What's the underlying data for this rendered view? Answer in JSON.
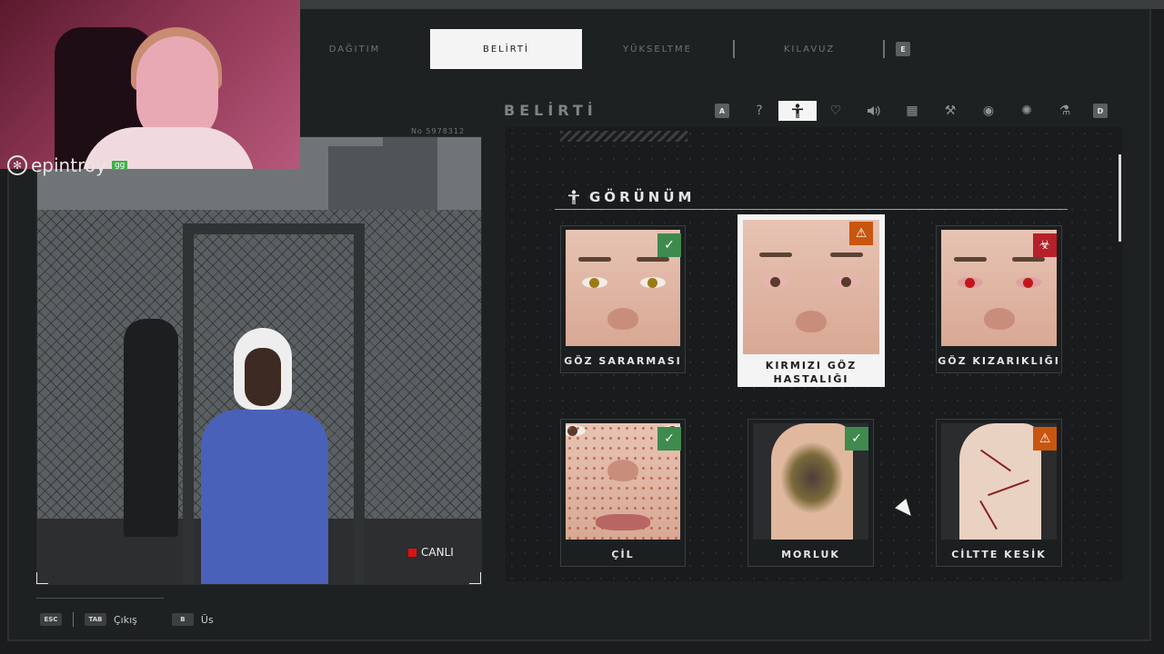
{
  "tabs": [
    {
      "label": "DAĞITIM",
      "active": false
    },
    {
      "label": "BELİRTİ",
      "active": true
    },
    {
      "label": "YÜKSELTME",
      "active": false
    },
    {
      "label": "KILAVUZ",
      "active": false
    }
  ],
  "tab_key_right": "E",
  "camera": {
    "id_text": "No 5978312",
    "live_label": "CANLI"
  },
  "webcam": {
    "brand": "epintroy",
    "brand_badge": "gg"
  },
  "panel": {
    "title": "BELİRTİ",
    "key_left": "A",
    "key_right": "D",
    "categories": [
      {
        "icon": "question-icon",
        "glyph": "?",
        "active": false
      },
      {
        "icon": "body-icon",
        "glyph": "🕴",
        "active": true
      },
      {
        "icon": "heartbeat-icon",
        "glyph": "♡",
        "active": false
      },
      {
        "icon": "sound-icon",
        "glyph": "🔊",
        "active": false
      },
      {
        "icon": "briefcase-icon",
        "glyph": "▦",
        "active": false
      },
      {
        "icon": "tools-icon",
        "glyph": "⚒",
        "active": false
      },
      {
        "icon": "eye-icon",
        "glyph": "◉",
        "active": false
      },
      {
        "icon": "virus-icon",
        "glyph": "✺",
        "active": false
      },
      {
        "icon": "flask-icon",
        "glyph": "⚗",
        "active": false
      }
    ],
    "section_title": "GÖRÜNÜM",
    "cards": [
      {
        "label": "GÖZ SARARMASI",
        "status": "ok",
        "status_icon": "check-shield-icon"
      },
      {
        "label_line1": "KIRMIZI GÖZ",
        "label_line2": "HASTALIĞI",
        "status": "warn",
        "status_icon": "warning-icon"
      },
      {
        "label": "GÖZ KIZARIKLIĞI",
        "status": "bio",
        "status_icon": "biohazard-icon"
      },
      {
        "label": "ÇİL",
        "status": "ok",
        "status_icon": "check-shield-icon"
      },
      {
        "label": "MORLUK",
        "status": "ok",
        "status_icon": "check-shield-icon"
      },
      {
        "label": "CİLTTE KESİK",
        "status": "warn",
        "status_icon": "warning-icon"
      }
    ]
  },
  "bottom_bar": {
    "esc_key": "ESC",
    "tab_key": "TAB",
    "exit_label": "Çıkış",
    "b_key": "B",
    "base_label": "Üs"
  },
  "colors": {
    "ok": "#3e8b4d",
    "warn": "#c8560f",
    "bio": "#b6202a",
    "live": "#e01010"
  }
}
